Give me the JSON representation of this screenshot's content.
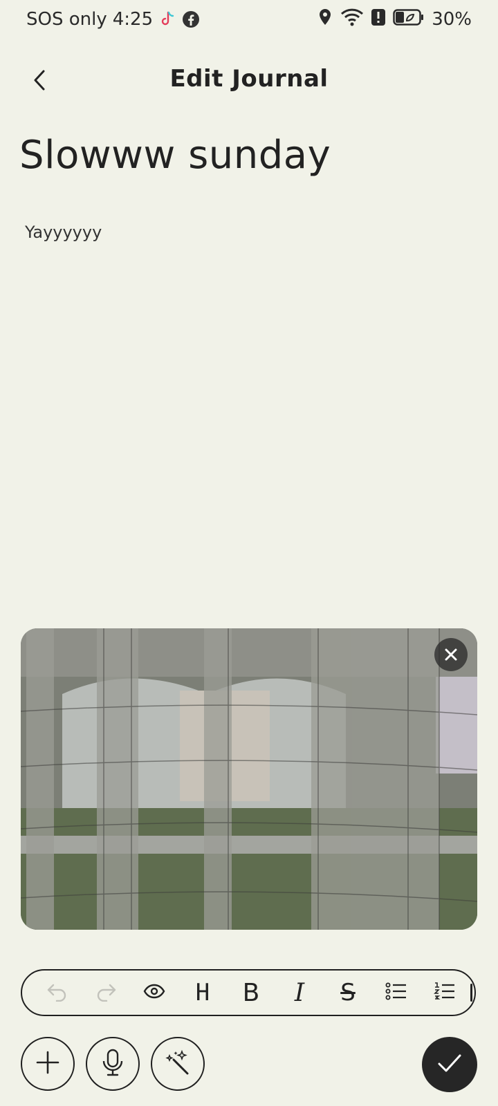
{
  "status_bar": {
    "carrier": "SOS only",
    "time": "4:25",
    "battery": "30%",
    "icons_left": [
      "tiktok-icon",
      "facebook-icon"
    ],
    "icons_right": [
      "location-icon",
      "wifi-icon",
      "alert-icon",
      "battery-saver-icon"
    ]
  },
  "header": {
    "title": "Edit Journal",
    "back_icon": "chevron-left-icon"
  },
  "entry": {
    "title": "Slowww sunday",
    "body": "Yayyyyyy"
  },
  "photo": {
    "description_icon": "photo-attachment",
    "remove_icon": "close-icon"
  },
  "toolbar": {
    "items": [
      "undo-icon",
      "redo-icon",
      "preview-eye-icon",
      "heading-icon",
      "bold-icon",
      "italic-icon",
      "strikethrough-icon",
      "bullet-list-icon",
      "numbered-list-icon"
    ],
    "heading_glyph": "H",
    "bold_glyph": "B",
    "italic_glyph": "I",
    "strike_glyph": "S"
  },
  "actions": [
    "add-icon",
    "microphone-icon",
    "magic-wand-icon",
    "checkmark-icon"
  ],
  "colors": {
    "background": "#f1f2e8",
    "text": "#222222",
    "fab": "#262626"
  }
}
